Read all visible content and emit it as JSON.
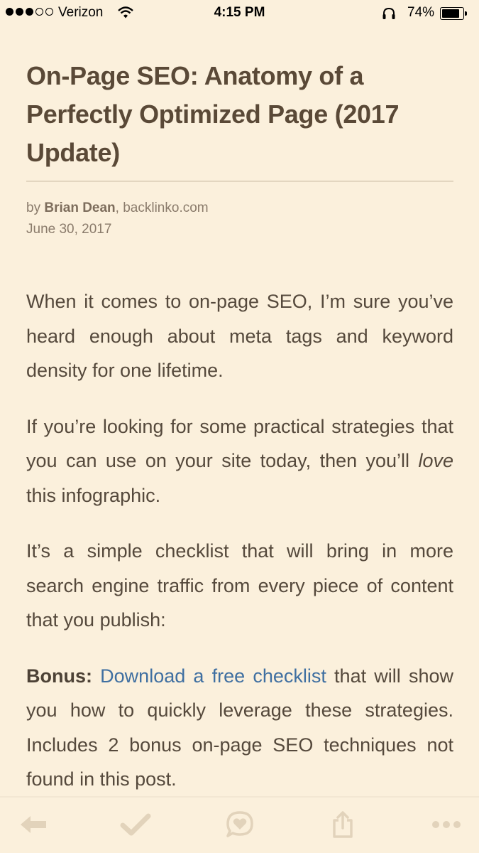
{
  "status_bar": {
    "carrier": "Verizon",
    "time": "4:15 PM",
    "battery_percent": "74%",
    "battery_level": 0.74,
    "signal_bars_filled": 3,
    "signal_bars_total": 5
  },
  "article": {
    "title": "On-Page SEO: Anatomy of a Perfectly Optimized Page (2017 Update)",
    "byline_prefix": "by ",
    "author": "Brian Dean",
    "byline_sep": ", ",
    "source": "backlinko.com",
    "date": "June 30, 2017",
    "p1": "When it comes to on-page SEO, I’m sure you’ve heard enough about meta tags and keyword density for one lifetime.",
    "p2_before": "If you’re looking for some practical strategies that you can use on your site today, then you’ll ",
    "p2_emphasis": "love",
    "p2_after": " this infographic.",
    "p3": "It’s a simple checklist that will bring in more search engine traffic from every piece of content that you publish:",
    "p4_label": "Bonus:",
    "p4_link": "Download a free checklist",
    "p4_after": " that will show you how to quickly leverage these strategies. Includes 2 bonus on-page SEO techniques not found in this post."
  },
  "toolbar": {
    "icons": [
      "back-arrow-icon",
      "checkmark-icon",
      "heart-comment-icon",
      "share-icon",
      "more-icon"
    ]
  },
  "colors": {
    "background": "#fbf0dc",
    "text": "#55493c",
    "link": "#3f6fa1",
    "toolbar_icon": "#e2d3bb"
  }
}
